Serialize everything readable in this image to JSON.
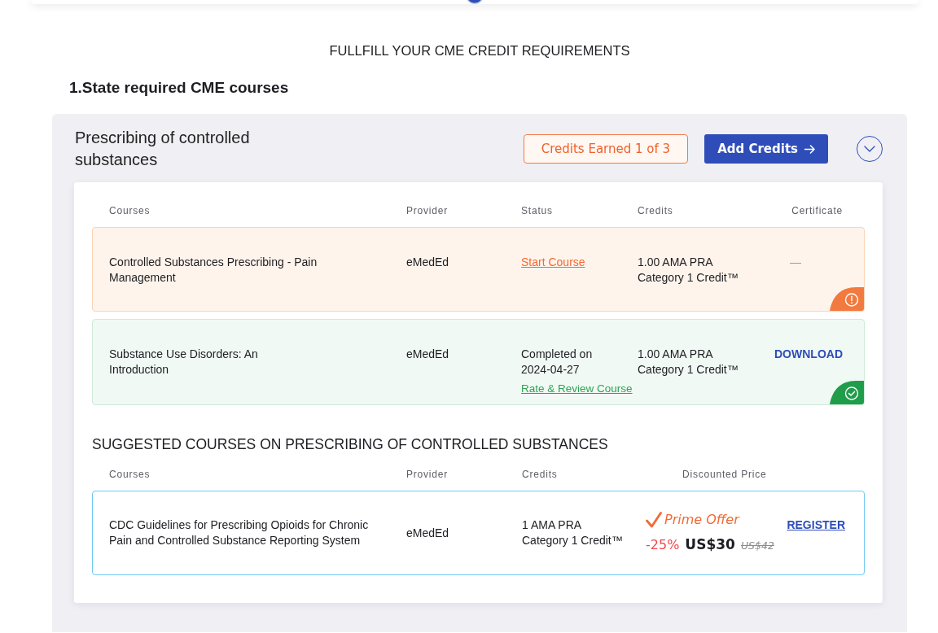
{
  "page_title": "FULLFILL YOUR CME CREDIT REQUIREMENTS",
  "section_title": "1.State required CME courses",
  "requirement": {
    "title": "Prescribing of controlled substances",
    "credits_badge": "Credits Earned 1 of 3",
    "add_button": "Add Credits",
    "expanded": true,
    "columns": [
      "Courses",
      "Provider",
      "Status",
      "Credits",
      "Certificate"
    ],
    "courses": [
      {
        "kind": "pending",
        "name": "Controlled Substances Prescribing - Pain Management",
        "provider": "eMedEd",
        "status": "Start Course",
        "credits": "1.00 AMA PRA Category 1 Credit™",
        "certificate": "—"
      },
      {
        "kind": "completed",
        "name": "Substance Use Disorders: An Introduction",
        "provider": "eMedEd",
        "status": "Completed on 2024-04-27",
        "review_link": "Rate & Review Course",
        "credits": "1.00 AMA PRA Category 1 Credit™",
        "certificate": "DOWNLOAD"
      }
    ],
    "suggested": {
      "heading": "SUGGESTED COURSES ON PRESCRIBING OF CONTROLLED SUBSTANCES",
      "columns": [
        "Courses",
        "Provider",
        "Credits",
        "Discounted Price"
      ],
      "courses": [
        {
          "name": "CDC Guidelines for Prescribing Opioids for Chronic Pain and Controlled Substance Reporting System",
          "provider": "eMedEd",
          "credits": "1 AMA PRA Category 1 Credit™",
          "offer": "Prime Offer",
          "discount": "-25%",
          "price": "US$30",
          "original_price": "US$42",
          "action": "REGISTER"
        }
      ]
    }
  }
}
